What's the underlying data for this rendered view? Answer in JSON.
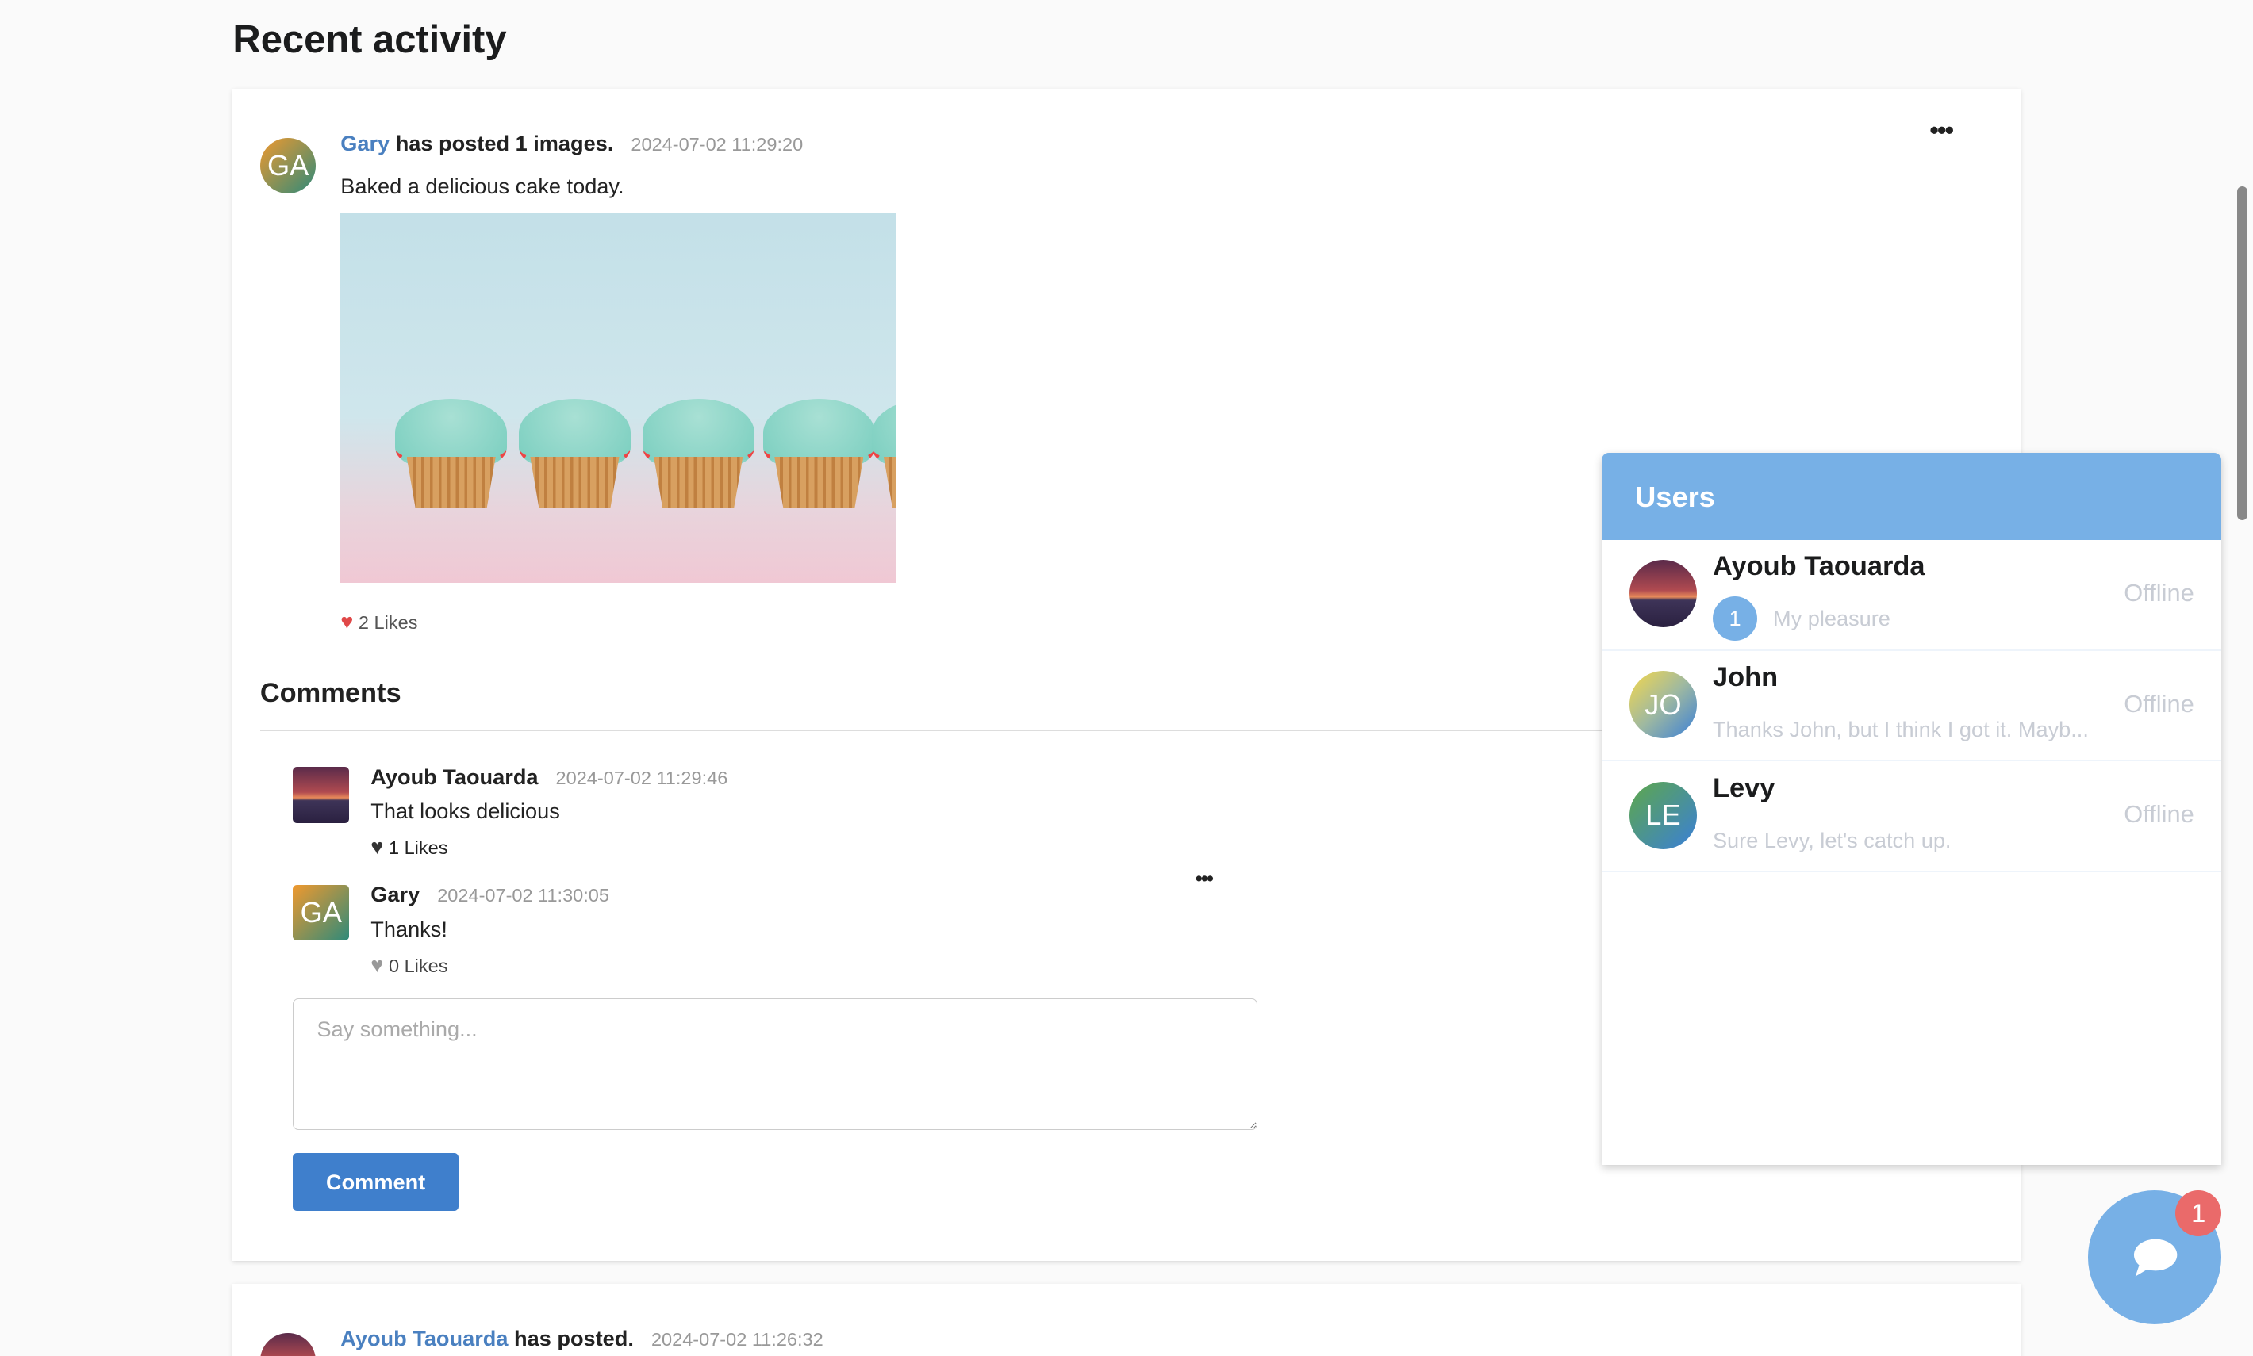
{
  "page": {
    "title": "Recent activity"
  },
  "post1": {
    "author": "Gary",
    "action": "has posted 1 images.",
    "timestamp": "2024-07-02 11:29:20",
    "avatar_initials": "GA",
    "text": "Baked a delicious cake today.",
    "likes": "2 Likes",
    "liked": true,
    "like_color": "#e04848"
  },
  "comments": {
    "title": "Comments",
    "items": [
      {
        "author": "Ayoub Taouarda",
        "timestamp": "2024-07-02 11:29:46",
        "text": "That looks delicious",
        "likes": "1 Likes"
      },
      {
        "author": "Gary",
        "avatar_initials": "GA",
        "timestamp": "2024-07-02 11:30:05",
        "text": "Thanks!",
        "likes": "0 Likes"
      }
    ],
    "input_placeholder": "Say something...",
    "input_value": "",
    "submit_label": "Comment"
  },
  "post2": {
    "author": "Ayoub Taouarda",
    "action": "has posted.",
    "timestamp": "2024-07-02 11:26:32"
  },
  "users_panel": {
    "title": "Users",
    "users": [
      {
        "name": "Ayoub Taouarda",
        "unread": "1",
        "last_message": "My pleasure",
        "status": "Offline"
      },
      {
        "name": "John",
        "avatar_initials": "JO",
        "last_message": "Thanks John, but I think I got it. Mayb...",
        "status": "Offline"
      },
      {
        "name": "Levy",
        "avatar_initials": "LE",
        "last_message": "Sure Levy, let's catch up.",
        "status": "Offline"
      }
    ]
  },
  "chat_button": {
    "icon": "chat-bubble-icon",
    "badge": "1"
  },
  "colors": {
    "accent": "#77b0e6",
    "link": "#4a80c0",
    "button": "#3f7fcc",
    "badge": "#ea6a6a"
  }
}
